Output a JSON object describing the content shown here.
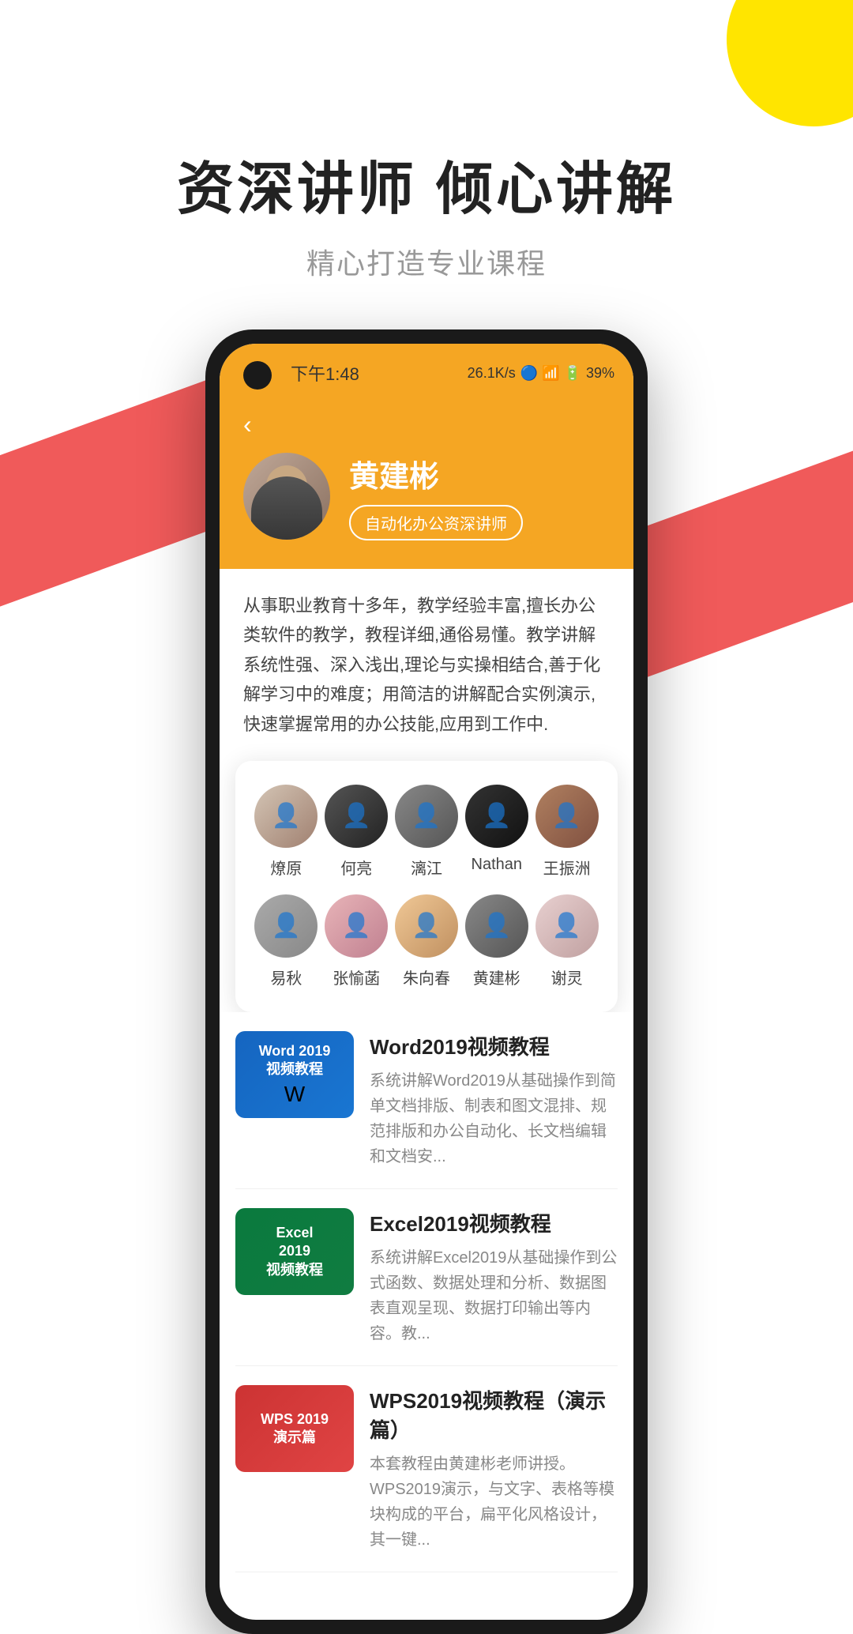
{
  "page": {
    "background": {
      "yellow_circle": true,
      "red_diagonals": true,
      "yellow_lines": true
    }
  },
  "header": {
    "main_title": "资深讲师  倾心讲解",
    "sub_title": "精心打造专业课程"
  },
  "phone": {
    "status_bar": {
      "time": "下午1:48",
      "network_speed": "26.1K/s",
      "battery": "39%",
      "indicators": "🔷📶🔋"
    },
    "teacher_profile": {
      "back_label": "‹",
      "name": "黄建彬",
      "badge": "自动化办公资深讲师",
      "bio": "从事职业教育十多年，教学经验丰富,擅长办公类软件的教学，教程详细,通俗易懂。教学讲解系统性强、深入浅出,理论与实操相结合,善于化解学习中的难度；用简洁的讲解配合实例演示,快速掌握常用的办公技能,应用到工作中."
    },
    "instructors": {
      "row1": [
        {
          "name": "燎原",
          "avatar_class": "av-1"
        },
        {
          "name": "何亮",
          "avatar_class": "av-2"
        },
        {
          "name": "漓江",
          "avatar_class": "av-3"
        },
        {
          "name": "Nathan",
          "avatar_class": "av-4"
        },
        {
          "name": "王振洲",
          "avatar_class": "av-5"
        }
      ],
      "row2": [
        {
          "name": "易秋",
          "avatar_class": "av-6"
        },
        {
          "name": "张愉菡",
          "avatar_class": "av-7"
        },
        {
          "name": "朱向春",
          "avatar_class": "av-8"
        },
        {
          "name": "黄建彬",
          "avatar_class": "av-9"
        },
        {
          "name": "谢灵",
          "avatar_class": "av-10"
        }
      ]
    },
    "courses": [
      {
        "id": "word2019",
        "title": "Word2019视频教程",
        "thumbnail_type": "word",
        "thumbnail_text": "Word 2019\n视频教程",
        "description": "系统讲解Word2019从基础操作到简单文档排版、制表和图文混排、规范排版和办公自动化、长文档编辑和文档安..."
      },
      {
        "id": "excel2019",
        "title": "Excel2019视频教程",
        "thumbnail_type": "excel",
        "thumbnail_text": "Excel\n2019\n视频教程",
        "description": "系统讲解Excel2019从基础操作到公式函数、数据处理和分析、数据图表直观呈现、数据打印输出等内容。教..."
      },
      {
        "id": "wps2019",
        "title": "WPS2019视频教程（演示篇）",
        "thumbnail_type": "wps",
        "thumbnail_text": "WPS 2019\n演示篇",
        "description": "本套教程由黄建彬老师讲授。WPS2019演示，与文字、表格等模块构成的平台，扁平化风格设计，其一键..."
      }
    ]
  }
}
